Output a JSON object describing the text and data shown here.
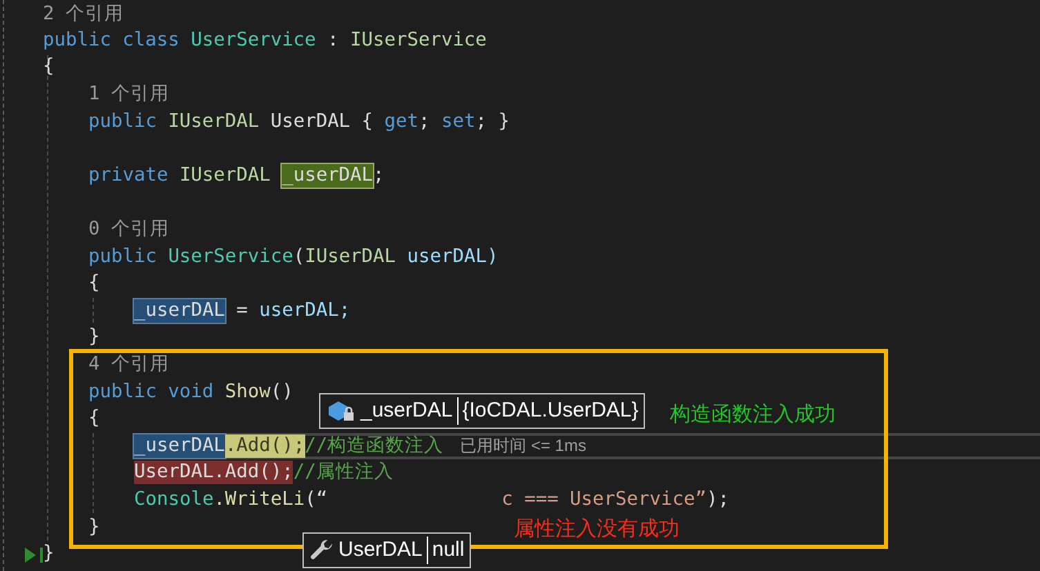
{
  "code_lines": [
    {
      "kind": "lens",
      "text": "2 个引用"
    },
    {
      "kind": "code",
      "tokens": [
        {
          "text": "public class ",
          "kind": "keyword"
        },
        {
          "text": "UserService",
          "kind": "type"
        },
        {
          "text": " : ",
          "kind": "plain"
        },
        {
          "text": "IUserService",
          "kind": "interface"
        }
      ]
    },
    {
      "kind": "code",
      "tokens": [
        {
          "text": "{",
          "kind": "plain"
        }
      ]
    },
    {
      "kind": "block",
      "children": [
        {
          "kind": "lens",
          "text": "1 个引用"
        },
        {
          "kind": "code",
          "tokens": [
            {
              "text": "public ",
              "kind": "keyword"
            },
            {
              "text": "IUserDAL",
              "kind": "interface"
            },
            {
              "text": " UserDAL { ",
              "kind": "plain"
            },
            {
              "text": "get",
              "kind": "keyword"
            },
            {
              "text": "; ",
              "kind": "plain"
            },
            {
              "text": "set",
              "kind": "keyword"
            },
            {
              "text": "; }",
              "kind": "plain"
            }
          ]
        },
        {
          "kind": "blank"
        },
        {
          "kind": "code",
          "tokens": [
            {
              "text": "private ",
              "kind": "keyword"
            },
            {
              "text": "IUserDAL ",
              "kind": "interface"
            },
            {
              "text": "_userDAL",
              "kind": "write-highlight"
            },
            {
              "text": ";",
              "kind": "plain"
            }
          ]
        },
        {
          "kind": "blank"
        },
        {
          "kind": "lens",
          "text": "0 个引用"
        },
        {
          "kind": "code",
          "tokens": [
            {
              "text": "public ",
              "kind": "keyword"
            },
            {
              "text": "UserService",
              "kind": "type"
            },
            {
              "text": "(",
              "kind": "plain"
            },
            {
              "text": "IUserDAL",
              "kind": "interface"
            },
            {
              "text": " userDAL)",
              "kind": "param"
            }
          ]
        },
        {
          "kind": "code",
          "tokens": [
            {
              "text": "{",
              "kind": "plain"
            }
          ]
        },
        {
          "kind": "block",
          "children": [
            {
              "kind": "code",
              "tokens": [
                {
                  "text": "_userDAL",
                  "kind": "reference-highlight"
                },
                {
                  "text": " = ",
                  "kind": "plain"
                },
                {
                  "text": "userDAL;",
                  "kind": "param"
                }
              ]
            }
          ]
        },
        {
          "kind": "code",
          "tokens": [
            {
              "text": "}",
              "kind": "plain"
            }
          ]
        },
        {
          "kind": "lens",
          "text": "4 个引用"
        },
        {
          "kind": "code",
          "tokens": [
            {
              "text": "public void ",
              "kind": "keyword"
            },
            {
              "text": "Show",
              "kind": "method"
            },
            {
              "text": "()",
              "kind": "plain"
            }
          ]
        },
        {
          "kind": "code",
          "tokens": [
            {
              "text": "{",
              "kind": "plain"
            }
          ]
        },
        {
          "kind": "block",
          "children": [
            {
              "kind": "code",
              "current": true,
              "hint": "已用时间 <= 1ms",
              "tokens": [
                {
                  "text": "_userDAL",
                  "kind": "reference-highlight"
                },
                {
                  "text": ".Add();",
                  "kind": "statement-highlight"
                },
                {
                  "text": "//构造函数注入",
                  "kind": "comment"
                }
              ]
            },
            {
              "kind": "code",
              "tokens": [
                {
                  "text": "UserDAL.Add();",
                  "kind": "error-highlight"
                },
                {
                  "text": "//属性注入",
                  "kind": "comment"
                }
              ]
            },
            {
              "kind": "code",
              "tokens": [
                {
                  "text": "Console",
                  "kind": "type"
                },
                {
                  "text": ".WriteLi",
                  "kind": "method"
                },
                {
                  "text": "(“",
                  "kind": "plain"
                },
                {
                  "text": "c === UserService”",
                  "kind": "string",
                  "gap_before": true
                },
                {
                  "text": ");",
                  "kind": "plain"
                }
              ]
            }
          ]
        },
        {
          "kind": "code",
          "tokens": [
            {
              "text": "}",
              "kind": "plain"
            }
          ]
        }
      ]
    },
    {
      "kind": "code",
      "run_marker": true,
      "tokens": [
        {
          "text": "}",
          "kind": "plain"
        }
      ]
    }
  ],
  "datatips": [
    {
      "kind": "field",
      "name": "_userDAL",
      "value": "{IoCDAL.UserDAL}"
    },
    {
      "kind": "property",
      "name": "UserDAL",
      "value": "null"
    }
  ],
  "annotations": [
    {
      "text": "构造函数注入成功",
      "color": "#22c52a"
    },
    {
      "text": "属性注入没有成功",
      "color": "#ff2a1a"
    }
  ]
}
